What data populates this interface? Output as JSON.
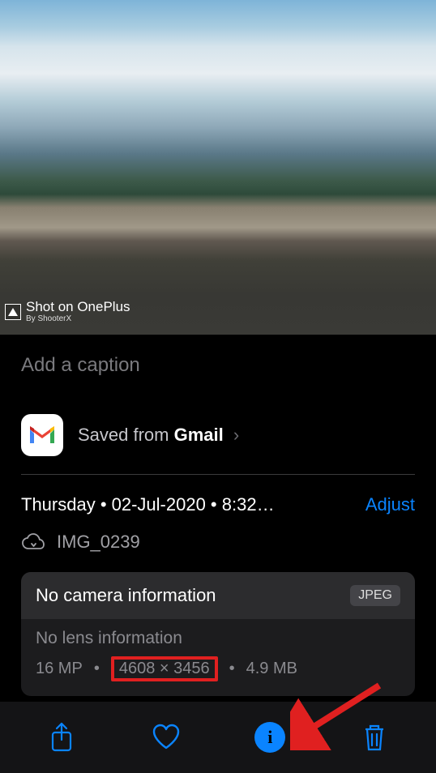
{
  "photo": {
    "watermark_title": "Shot on OnePlus",
    "watermark_sub": "By ShooterX"
  },
  "caption": {
    "placeholder": "Add a caption"
  },
  "saved_from": {
    "prefix": "Saved from ",
    "app": "Gmail"
  },
  "meta": {
    "datetime_display": "Thursday • 02-Jul-2020 • 8:32…",
    "adjust_label": "Adjust",
    "filename": "IMG_0239"
  },
  "card": {
    "camera_info": "No camera information",
    "format_badge": "JPEG",
    "lens_info": "No lens information",
    "megapixels": "16 MP",
    "dimensions": "4608 × 3456",
    "filesize": "4.9 MB"
  },
  "toolbar": {
    "share": "share",
    "favorite": "favorite",
    "info": "info",
    "delete": "delete"
  },
  "colors": {
    "accent": "#0a84ff",
    "annotation_red": "#e02020"
  }
}
